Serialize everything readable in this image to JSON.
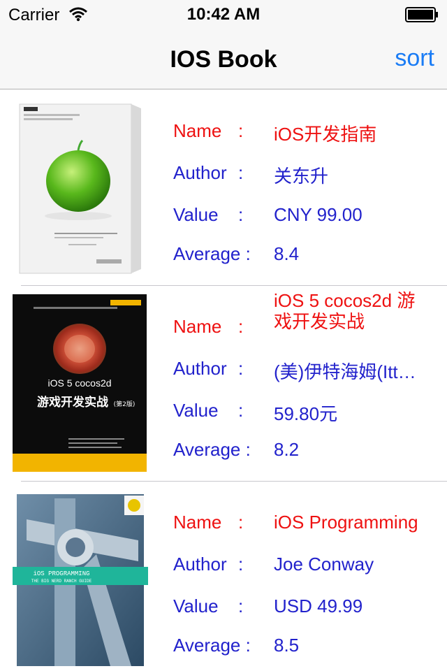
{
  "status_bar": {
    "carrier": "Carrier",
    "time": "10:42 AM"
  },
  "nav": {
    "title": "IOS Book",
    "sort_label": "sort"
  },
  "labels": {
    "name": "Name",
    "author": "Author",
    "value": "Value",
    "average": "Average",
    "colon": ":"
  },
  "books": [
    {
      "name": "iOS开发指南",
      "author": "关东升",
      "value": "CNY 99.00",
      "average": "8.4",
      "cover_text": "iOS开发指南"
    },
    {
      "name": "iOS 5 cocos2d 游戏开发实战",
      "author": "(美)伊特海姆(Itt…",
      "value": "59.80元",
      "average": "8.2",
      "cover_title": "iOS 5 cocos2d",
      "cover_subtitle": "游戏开发实战",
      "cover_edition": "(第2版)"
    },
    {
      "name": "iOS Programming",
      "author": "Joe Conway",
      "value": "USD 49.99",
      "average": "8.5",
      "cover_title": "iOS PROGRAMMING",
      "cover_subtitle": "THE BIG NERD RANCH GUIDE"
    }
  ],
  "colors": {
    "accent": "#1a7cf5",
    "name_color": "#ee1111",
    "field_color": "#2222cc"
  }
}
